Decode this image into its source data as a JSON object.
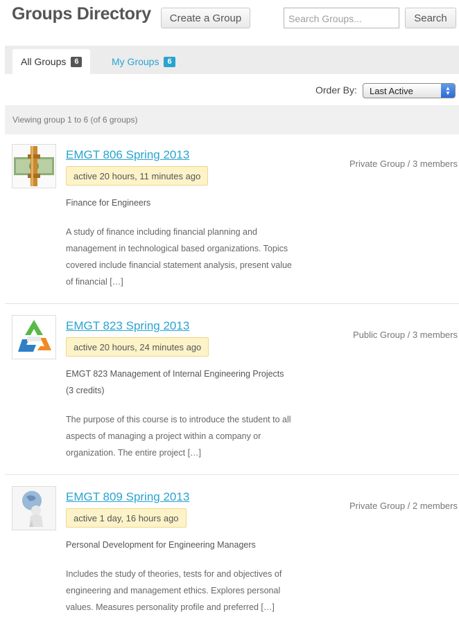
{
  "header": {
    "title": "Groups Directory",
    "create_label": "Create a Group",
    "search_placeholder": "Search Groups...",
    "search_label": "Search"
  },
  "tabs": [
    {
      "label": "All Groups",
      "count": "6"
    },
    {
      "label": "My Groups",
      "count": "6"
    }
  ],
  "order": {
    "label": "Order By:",
    "selected": "Last Active"
  },
  "pagination": {
    "text": "Viewing group 1 to 6 (of 6 groups)"
  },
  "groups": [
    {
      "title": "EMGT 806 Spring 2013",
      "active": "active 20 hours, 11 minutes ago",
      "meta": "Private Group / 3 members",
      "subtitle": "Finance for Engineers",
      "description": "A study of finance including financial planning and management in technological based organizations. Topics covered include financial statement analysis, present value of financial […]"
    },
    {
      "title": "EMGT 823 Spring 2013",
      "active": "active 20 hours, 24 minutes ago",
      "meta": "Public Group / 3 members",
      "subtitle": "EMGT 823 Management of Internal Engineering Projects (3 credits)",
      "description": "The purpose of this course is to introduce the student to all aspects of managing a project within a company or organization. The entire project […]"
    },
    {
      "title": "EMGT 809 Spring 2013",
      "active": "active 1 day, 16 hours ago",
      "meta": "Private Group / 2 members",
      "subtitle": "Personal Development for Engineering Managers",
      "description": "Includes the study of theories, tests for and objectives of engineering and management ethics. Explores personal values. Measures personality profile and preferred […]"
    }
  ]
}
